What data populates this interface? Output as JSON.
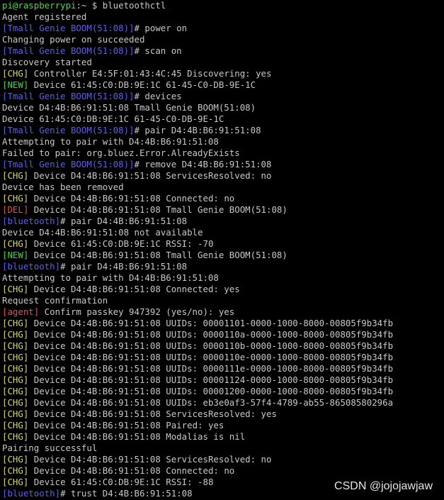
{
  "colors": {
    "background": "#000000",
    "text": "#c8c8c8",
    "user_host": "#4fd64f",
    "bt_prompt": "#5c5cff",
    "chg": "#d7d75f",
    "new": "#3fd33f",
    "del": "#e05050",
    "agent": "#e05050",
    "watermark": "#e6e6e6"
  },
  "terminal": {
    "lines": [
      [
        {
          "t": "pi@raspberrypi",
          "c": "user_host"
        },
        {
          "t": ":~ $ bluetoothctl",
          "c": "text"
        }
      ],
      [
        {
          "t": "Agent registered",
          "c": "text"
        }
      ],
      [
        {
          "t": "[Tmall Genie BOOM(51:08)]",
          "c": "bt_prompt"
        },
        {
          "t": "# power on",
          "c": "text"
        }
      ],
      [
        {
          "t": "Changing power on succeeded",
          "c": "text"
        }
      ],
      [
        {
          "t": "[Tmall Genie BOOM(51:08)]",
          "c": "bt_prompt"
        },
        {
          "t": "# scan on",
          "c": "text"
        }
      ],
      [
        {
          "t": "Discovery started",
          "c": "text"
        }
      ],
      [
        {
          "t": "[CHG]",
          "c": "chg"
        },
        {
          "t": " Controller E4:5F:01:43:4C:45 Discovering: yes",
          "c": "text"
        }
      ],
      [
        {
          "t": "[NEW]",
          "c": "new"
        },
        {
          "t": " Device 61:45:C0:DB:9E:1C 61-45-C0-DB-9E-1C",
          "c": "text"
        }
      ],
      [
        {
          "t": "[Tmall Genie BOOM(51:08)]",
          "c": "bt_prompt"
        },
        {
          "t": "# devices",
          "c": "text"
        }
      ],
      [
        {
          "t": "Device D4:4B:B6:91:51:08 Tmall Genie BOOM(51:08)",
          "c": "text"
        }
      ],
      [
        {
          "t": "Device 61:45:C0:DB:9E:1C 61-45-C0-DB-9E-1C",
          "c": "text"
        }
      ],
      [
        {
          "t": "[Tmall Genie BOOM(51:08)]",
          "c": "bt_prompt"
        },
        {
          "t": "# pair D4:4B:B6:91:51:08",
          "c": "text"
        }
      ],
      [
        {
          "t": "Attempting to pair with D4:4B:B6:91:51:08",
          "c": "text"
        }
      ],
      [
        {
          "t": "Failed to pair: org.bluez.Error.AlreadyExists",
          "c": "text"
        }
      ],
      [
        {
          "t": "[Tmall Genie BOOM(51:08)]",
          "c": "bt_prompt"
        },
        {
          "t": "# remove D4:4B:B6:91:51:08",
          "c": "text"
        }
      ],
      [
        {
          "t": "[CHG]",
          "c": "chg"
        },
        {
          "t": " Device D4:4B:B6:91:51:08 ServicesResolved: no",
          "c": "text"
        }
      ],
      [
        {
          "t": "Device has been removed",
          "c": "text"
        }
      ],
      [
        {
          "t": "[CHG]",
          "c": "chg"
        },
        {
          "t": " Device D4:4B:B6:91:51:08 Connected: no",
          "c": "text"
        }
      ],
      [
        {
          "t": "[DEL]",
          "c": "del"
        },
        {
          "t": " Device D4:4B:B6:91:51:08 Tmall Genie BOOM(51:08)",
          "c": "text"
        }
      ],
      [
        {
          "t": "[bluetooth]",
          "c": "bt_prompt"
        },
        {
          "t": "# pair D4:4B:B6:91:51:08",
          "c": "text"
        }
      ],
      [
        {
          "t": "Device D4:4B:B6:91:51:08 not available",
          "c": "text"
        }
      ],
      [
        {
          "t": "[CHG]",
          "c": "chg"
        },
        {
          "t": " Device 61:45:C0:DB:9E:1C RSSI: -70",
          "c": "text"
        }
      ],
      [
        {
          "t": "[NEW]",
          "c": "new"
        },
        {
          "t": " Device D4:4B:B6:91:51:08 Tmall Genie BOOM(51:08)",
          "c": "text"
        }
      ],
      [
        {
          "t": "[bluetooth]",
          "c": "bt_prompt"
        },
        {
          "t": "# pair D4:4B:B6:91:51:08",
          "c": "text"
        }
      ],
      [
        {
          "t": "Attempting to pair with D4:4B:B6:91:51:08",
          "c": "text"
        }
      ],
      [
        {
          "t": "[CHG]",
          "c": "chg"
        },
        {
          "t": " Device D4:4B:B6:91:51:08 Connected: yes",
          "c": "text"
        }
      ],
      [
        {
          "t": "Request confirmation",
          "c": "text"
        }
      ],
      [
        {
          "t": "[agent]",
          "c": "agent"
        },
        {
          "t": " Confirm passkey 947392 (yes/no): yes",
          "c": "text"
        }
      ],
      [
        {
          "t": "[CHG]",
          "c": "chg"
        },
        {
          "t": " Device D4:4B:B6:91:51:08 UUIDs: 00001101-0000-1000-8000-00805f9b34fb",
          "c": "text"
        }
      ],
      [
        {
          "t": "[CHG]",
          "c": "chg"
        },
        {
          "t": " Device D4:4B:B6:91:51:08 UUIDs: 0000110a-0000-1000-8000-00805f9b34fb",
          "c": "text"
        }
      ],
      [
        {
          "t": "[CHG]",
          "c": "chg"
        },
        {
          "t": " Device D4:4B:B6:91:51:08 UUIDs: 0000110b-0000-1000-8000-00805f9b34fb",
          "c": "text"
        }
      ],
      [
        {
          "t": "[CHG]",
          "c": "chg"
        },
        {
          "t": " Device D4:4B:B6:91:51:08 UUIDs: 0000110e-0000-1000-8000-00805f9b34fb",
          "c": "text"
        }
      ],
      [
        {
          "t": "[CHG]",
          "c": "chg"
        },
        {
          "t": " Device D4:4B:B6:91:51:08 UUIDs: 0000111e-0000-1000-8000-00805f9b34fb",
          "c": "text"
        }
      ],
      [
        {
          "t": "[CHG]",
          "c": "chg"
        },
        {
          "t": " Device D4:4B:B6:91:51:08 UUIDs: 00001124-0000-1000-8000-00805f9b34fb",
          "c": "text"
        }
      ],
      [
        {
          "t": "[CHG]",
          "c": "chg"
        },
        {
          "t": " Device D4:4B:B6:91:51:08 UUIDs: 00001200-0000-1000-8000-00805f9b34fb",
          "c": "text"
        }
      ],
      [
        {
          "t": "[CHG]",
          "c": "chg"
        },
        {
          "t": " Device D4:4B:B6:91:51:08 UUIDs: eb3e0af3-57f4-4789-ab55-86508580296a",
          "c": "text"
        }
      ],
      [
        {
          "t": "[CHG]",
          "c": "chg"
        },
        {
          "t": " Device D4:4B:B6:91:51:08 ServicesResolved: yes",
          "c": "text"
        }
      ],
      [
        {
          "t": "[CHG]",
          "c": "chg"
        },
        {
          "t": " Device D4:4B:B6:91:51:08 Paired: yes",
          "c": "text"
        }
      ],
      [
        {
          "t": "[CHG]",
          "c": "chg"
        },
        {
          "t": " Device D4:4B:B6:91:51:08 Modalias is nil",
          "c": "text"
        }
      ],
      [
        {
          "t": "Pairing successful",
          "c": "text"
        }
      ],
      [
        {
          "t": "[CHG]",
          "c": "chg"
        },
        {
          "t": " Device D4:4B:B6:91:51:08 ServicesResolved: no",
          "c": "text"
        }
      ],
      [
        {
          "t": "[CHG]",
          "c": "chg"
        },
        {
          "t": " Device D4:4B:B6:91:51:08 Connected: no",
          "c": "text"
        }
      ],
      [
        {
          "t": "[CHG]",
          "c": "chg"
        },
        {
          "t": " Device 61:45:C0:DB:9E:1C RSSI: -88",
          "c": "text"
        }
      ],
      [
        {
          "t": "[bluetooth]",
          "c": "bt_prompt"
        },
        {
          "t": "# trust D4:4B:B6:91:51:08",
          "c": "text"
        }
      ]
    ]
  },
  "watermark": {
    "text": "CSDN @jojojawjaw"
  }
}
